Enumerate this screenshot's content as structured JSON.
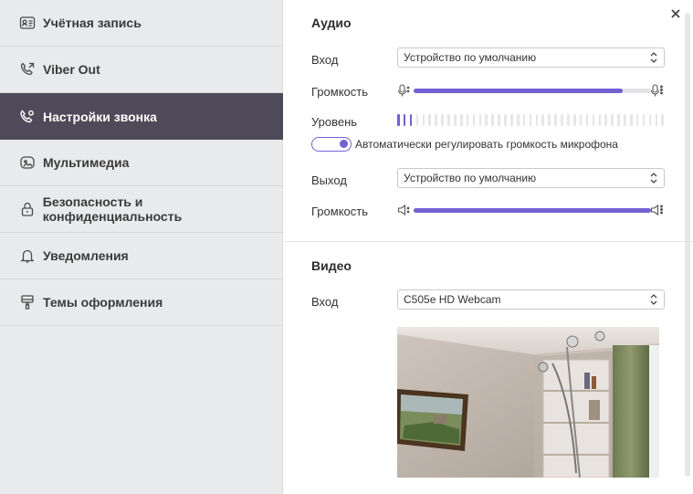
{
  "sidebar": {
    "items": [
      {
        "label": "Учётная запись",
        "icon": "account-card-icon"
      },
      {
        "label": "Viber Out",
        "icon": "phone-out-icon"
      },
      {
        "label": "Настройки звонка",
        "icon": "phone-settings-icon",
        "active": true
      },
      {
        "label": "Мультимедиа",
        "icon": "media-icon"
      },
      {
        "label": "Безопасность и конфиденциальность",
        "icon": "lock-icon"
      },
      {
        "label": "Уведомления",
        "icon": "bell-icon"
      },
      {
        "label": "Темы оформления",
        "icon": "brush-icon"
      }
    ]
  },
  "audio": {
    "title": "Аудио",
    "input_label": "Вход",
    "input_value": "Устройство по умолчанию",
    "input_volume_label": "Громкость",
    "input_volume": 0.88,
    "level_label": "Уровень",
    "level_active_bars": 3,
    "level_total_bars": 43,
    "auto_gain_label": "Автоматически регулировать громкость микрофона",
    "auto_gain_on": true,
    "output_label": "Выход",
    "output_value": "Устройство по умолчанию",
    "output_volume_label": "Громкость",
    "output_volume": 1.0
  },
  "video": {
    "title": "Видео",
    "input_label": "Вход",
    "input_value": "C505e HD Webcam"
  },
  "colors": {
    "accent": "#7360d3",
    "sidebar_bg": "#e9eaeb",
    "sidebar_active": "#4f4a5a"
  }
}
